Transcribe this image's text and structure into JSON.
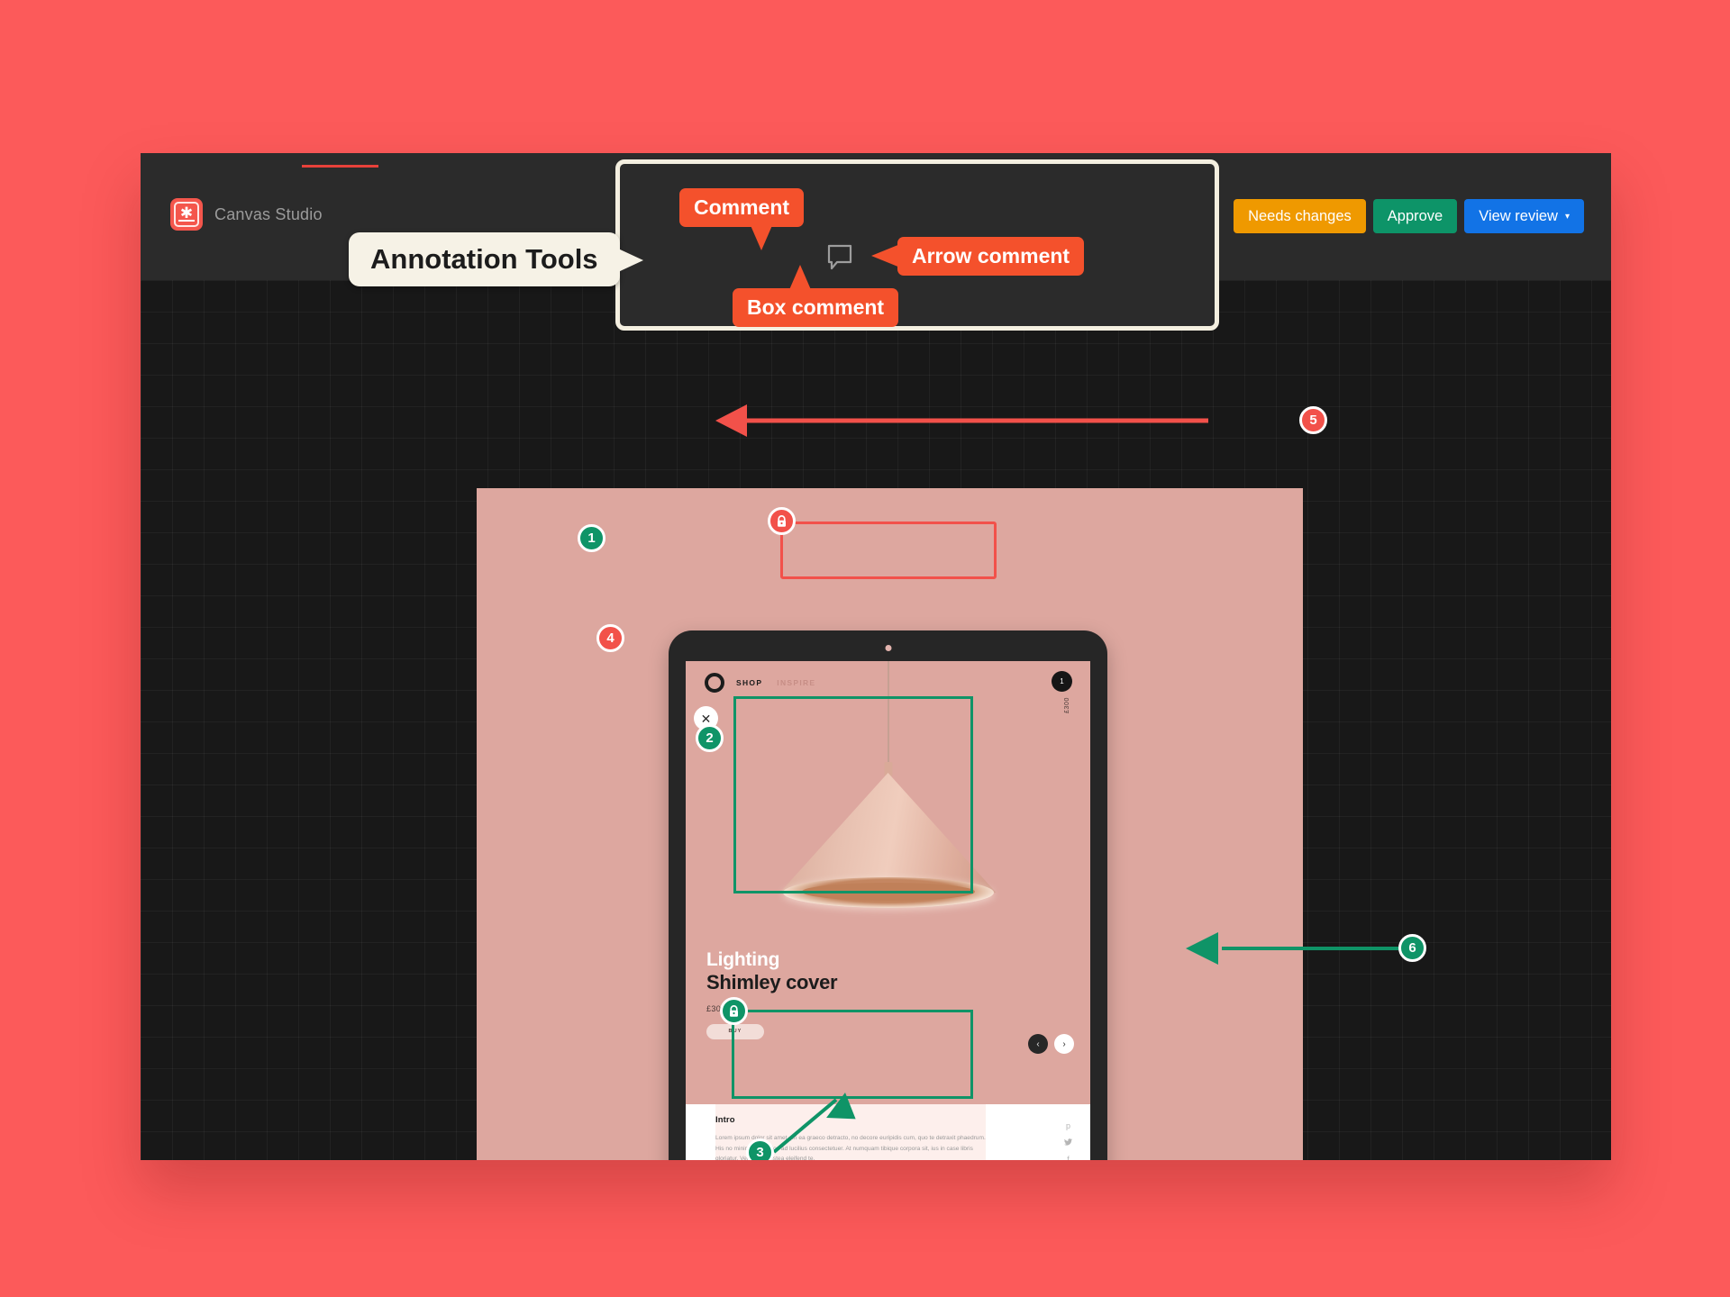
{
  "app": {
    "brand_name": "Canvas Studio",
    "brand_icon": "asterisk-logo-icon"
  },
  "header": {
    "buttons": [
      {
        "label": "Needs changes",
        "color": "#ef9900",
        "name": "needs-changes-button"
      },
      {
        "label": "Approve",
        "color": "#0d9468",
        "name": "approve-button"
      },
      {
        "label": "View review",
        "color": "#1273e6",
        "name": "view-review-button",
        "caret": "▾"
      }
    ]
  },
  "toolbar": {
    "tools": [
      {
        "name": "comment-tool",
        "icon": "speech-bubble-icon"
      },
      {
        "name": "box-comment-tool",
        "icon": "selection-box-icon"
      },
      {
        "name": "arrow-comment-tool",
        "icon": "cursor-arrow-icon"
      }
    ]
  },
  "callouts": {
    "comment": "Comment",
    "box_comment": "Box comment",
    "arrow_comment": "Arrow comment",
    "annotation_tools": "Annotation Tools"
  },
  "markers": [
    {
      "id": "1",
      "label": "1",
      "color": "#0f9467",
      "type": "green"
    },
    {
      "id": "2",
      "label": "2",
      "color": "#0f9467",
      "type": "green"
    },
    {
      "id": "3",
      "label": "3",
      "color": "#0f9467",
      "type": "green"
    },
    {
      "id": "4",
      "label": "4",
      "color": "#f2514a",
      "type": "red"
    },
    {
      "id": "5",
      "label": "5",
      "color": "#f2514a",
      "type": "red"
    },
    {
      "id": "6",
      "label": "6",
      "color": "#0f9467",
      "type": "green"
    }
  ],
  "annotations": {
    "red_box_lock_icon": "lock-icon",
    "intro_box_lock_icon": "lock-icon"
  },
  "mockup": {
    "nav": {
      "logo": "circle-logo-icon",
      "links": [
        {
          "label": "SHOP",
          "active": true
        },
        {
          "label": "INSPIRE",
          "active": false
        }
      ],
      "cart_count": "1",
      "cart_price": "£300",
      "close_label": "✕"
    },
    "product": {
      "category": "Lighting",
      "name": "Shimley cover",
      "price": "£300",
      "buy_label": "BUY"
    },
    "carousel": {
      "prev": "‹",
      "next": "›"
    },
    "intro": {
      "title": "Intro",
      "body": "Lorem ipsum dolor sit amet, pri ea graeco detracto, no decore euripidis cum, quo te detraxit phaedrum. His no minim paulo. Eos ad lucilius consectetuer. At numquam tibique corpora sit, ius in case libris gloriatur. Vel modo postea eleifend te.",
      "social": [
        {
          "name": "pinterest-icon",
          "glyph": "p"
        },
        {
          "name": "twitter-icon",
          "glyph": "✈"
        },
        {
          "name": "facebook-icon",
          "glyph": "f"
        }
      ]
    }
  },
  "colors": {
    "page_background": "#fc5a5a",
    "app_chrome": "#2b2b2b",
    "canvas": "#181818",
    "artboard": "#dda79f",
    "accent_green": "#0f9467",
    "accent_red": "#f2514a",
    "callout_red": "#f4512c",
    "callout_cream": "#f6f2e6"
  }
}
